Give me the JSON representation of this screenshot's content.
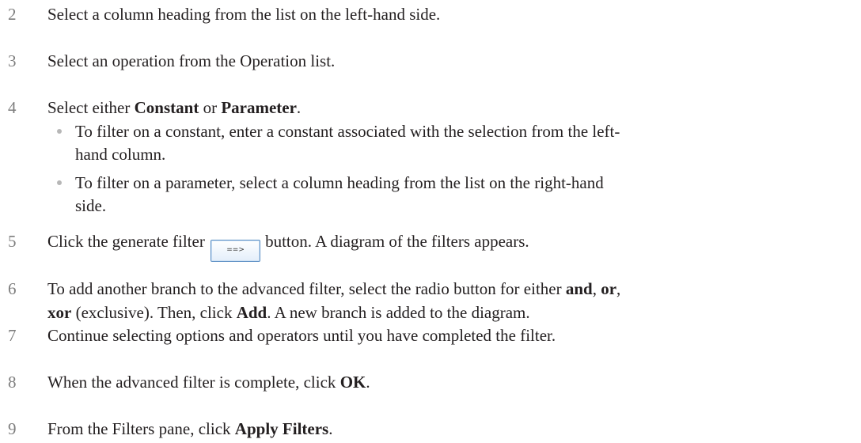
{
  "steps": [
    {
      "num": "2",
      "text": "Select a column heading from the list on the left-hand side."
    },
    {
      "num": "3",
      "text": "Select an operation from the Operation list."
    },
    {
      "num": "4",
      "text_before": "Select either ",
      "bold1": "Constant",
      "text_mid": " or ",
      "bold2": "Parameter",
      "text_after": ".",
      "bullets": [
        {
          "line1": "To filter on a constant, enter a constant associated with the selection from the left-",
          "line2": "hand column."
        },
        {
          "line1": "To filter on a parameter, select a column heading from the list on the right-hand",
          "line2": "side."
        }
      ]
    },
    {
      "num": "5",
      "text_before": "Click the generate filter",
      "button_label": "==>",
      "text_after": "button. A diagram of the filters appears."
    },
    {
      "num": "6",
      "l1_before": "To add another branch to the advanced filter, select the radio button for either ",
      "b_and": "and",
      "comma1": ", ",
      "b_or": "or",
      "comma2": ",",
      "b_xor": "xor",
      "l2_mid": " (exclusive). Then, click ",
      "b_add": "Add",
      "l2_after": ". A new branch is added to the diagram."
    },
    {
      "num": "7",
      "text": "Continue selecting options and operators until you have completed the filter."
    },
    {
      "num": "8",
      "text_before": "When the advanced filter is complete, click ",
      "bold": "OK",
      "text_after": "."
    },
    {
      "num": "9",
      "text_before": "From the Filters pane, click ",
      "bold": "Apply Filters",
      "text_after": "."
    }
  ]
}
